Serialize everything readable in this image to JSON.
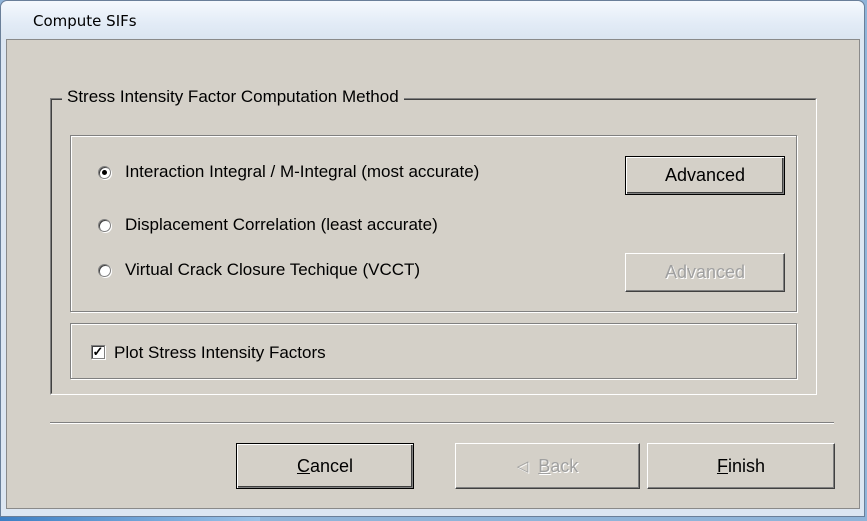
{
  "window": {
    "title": "Compute SIFs"
  },
  "group": {
    "caption": "Stress Intensity Factor Computation Method"
  },
  "methods": [
    {
      "label": "Interaction Integral / M-Integral (most accurate)",
      "checked": true
    },
    {
      "label": "Displacement Correlation (least accurate)",
      "checked": false
    },
    {
      "label": "Virtual Crack Closure Techique (VCCT)",
      "checked": false
    }
  ],
  "advanced": {
    "label": "Advanced"
  },
  "advanced_vcct": {
    "label": "Advanced",
    "disabled": true
  },
  "plot": {
    "label": "Plot Stress Intensity Factors",
    "checked": true,
    "mark": "✓"
  },
  "buttons": {
    "cancel": {
      "mnemonic": "C",
      "rest": "ancel"
    },
    "back": {
      "arrow": "◁",
      "mnemonic": "B",
      "rest": "ack",
      "disabled": true
    },
    "finish": {
      "mnemonic": "F",
      "rest": "inish"
    }
  }
}
